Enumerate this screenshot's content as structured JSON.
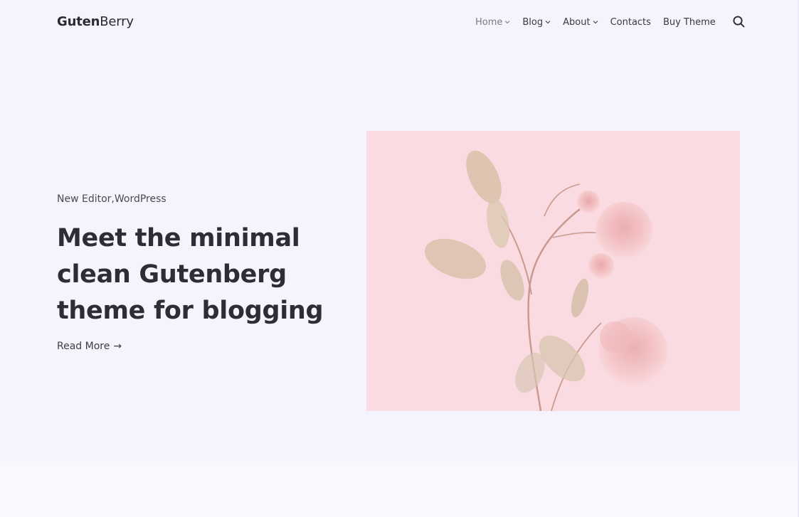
{
  "header": {
    "logo_bold": "Guten",
    "logo_light": "Berry",
    "nav": [
      {
        "label": "Home",
        "has_dropdown": true,
        "active": true
      },
      {
        "label": "Blog",
        "has_dropdown": true,
        "active": false
      },
      {
        "label": "About",
        "has_dropdown": true,
        "active": false
      },
      {
        "label": "Contacts",
        "has_dropdown": false,
        "active": false
      },
      {
        "label": "Buy Theme",
        "has_dropdown": false,
        "active": false
      }
    ],
    "search_icon": "search-icon"
  },
  "hero": {
    "categories": [
      "New Editor",
      "WordPress"
    ],
    "category_separator": ",",
    "title": "Meet the minimal clean Gutenberg theme for blogging",
    "read_more": "Read More",
    "read_more_arrow": "→",
    "image_subject": "pink roses and leaves on a pink background"
  },
  "colors": {
    "background": "#f4f4fe",
    "text": "#2e2d34",
    "image_bg": "#fadbe1",
    "nav_active": "#7b7a84"
  }
}
